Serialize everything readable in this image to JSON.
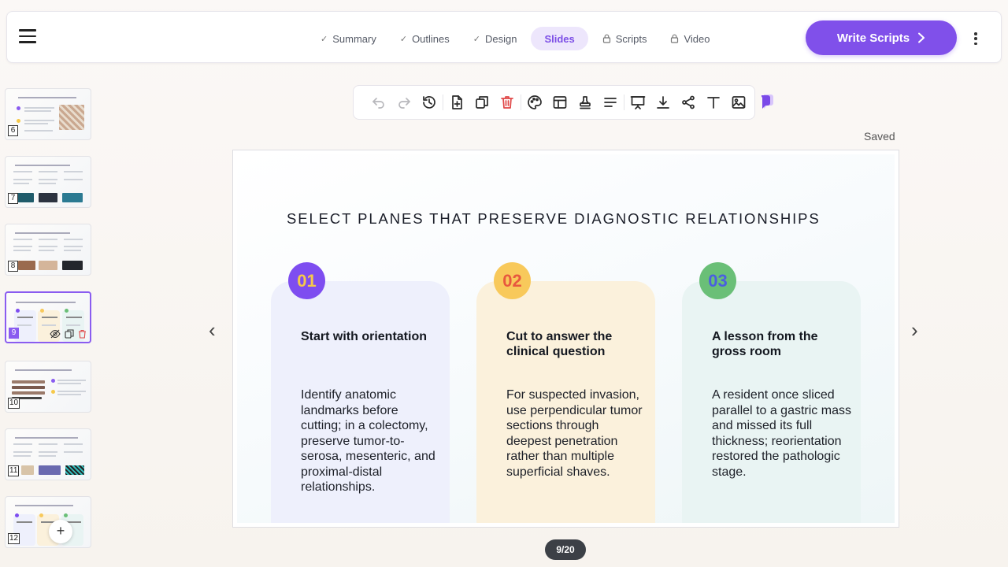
{
  "topbar": {
    "steps": [
      {
        "label": "Summary",
        "icon": "check-icon",
        "state": "done"
      },
      {
        "label": "Outlines",
        "icon": "check-icon",
        "state": "done"
      },
      {
        "label": "Design",
        "icon": "check-icon",
        "state": "done"
      },
      {
        "label": "Slides",
        "icon": "",
        "state": "active"
      },
      {
        "label": "Scripts",
        "icon": "lock-icon",
        "state": "locked"
      },
      {
        "label": "Video",
        "icon": "lock-icon",
        "state": "locked"
      }
    ],
    "write_button": "Write Scripts"
  },
  "status": {
    "saved": "Saved"
  },
  "sidebar": {
    "thumbnails": [
      {
        "number": "6"
      },
      {
        "number": "7"
      },
      {
        "number": "8"
      },
      {
        "number": "9",
        "selected": true
      },
      {
        "number": "10"
      },
      {
        "number": "11"
      },
      {
        "number": "12"
      }
    ]
  },
  "slide": {
    "title": "SELECT PLANES THAT PRESERVE DIAGNOSTIC RELATIONSHIPS",
    "cards": [
      {
        "number": "01",
        "title": "Start with orientation",
        "body": "Identify anatomic landmarks before cutting; in a colectomy, preserve tumor-to-serosa, mesenteric, and proximal-distal relationships.",
        "badge_color": "#7e4df0",
        "badge_text_color": "#f6c94a",
        "card_color": "#eef0fc"
      },
      {
        "number": "02",
        "title": "Cut to answer the clinical question",
        "body": "For suspected invasion, use perpendicular tumor sections through deepest penetration rather than multiple superficial shaves.",
        "badge_color": "#f8c95b",
        "badge_text_color": "#e8583e",
        "card_color": "#fbf1dc"
      },
      {
        "number": "03",
        "title": "A lesson from the gross room",
        "body": "A resident once sliced parallel to a gastric mass and missed its full thickness; reorientation restored the pathologic stage.",
        "badge_color": "#6abf77",
        "badge_text_color": "#4a5fe0",
        "card_color": "#e9f4f3"
      }
    ]
  },
  "pager": "9/20",
  "colors": {
    "accent": "#8050ea",
    "danger": "#e04848"
  }
}
